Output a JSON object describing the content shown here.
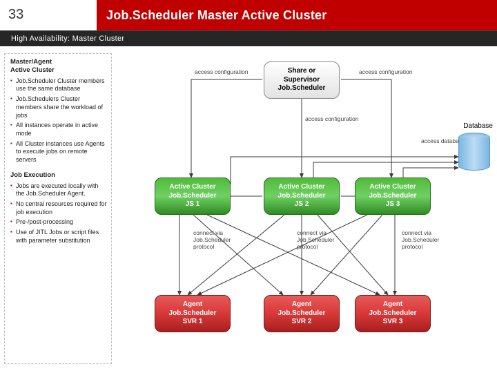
{
  "slide_number": "33",
  "title": "Job.Scheduler Master Active Cluster",
  "subtitle": "High Availability: Master Cluster",
  "sidebar": {
    "h1": "Master/Agent\nActive Cluster",
    "list1": [
      "Job.Scheduler Cluster members use the same database",
      "Job.Schedulers Cluster members share the workload of jobs",
      "All instances operate in active mode",
      "All Cluster instances use Agents to execute jobs on remote servers"
    ],
    "h2": "Job Execution",
    "list2": [
      "Jobs are executed locally with the Job.Scheduler Agent.",
      "No central resources required for job execution",
      "Pre-/post-processing",
      "Use of JITL Jobs or script files with parameter substitution"
    ]
  },
  "diagram": {
    "supervisor": "Share or\nSupervisor\nJob.Scheduler",
    "access_cfg": "access configuration",
    "access_db": "access database",
    "database": "Database",
    "clusters": [
      "Active Cluster\nJob.Scheduler\nJS 1",
      "Active Cluster\nJob.Scheduler\nJS 2",
      "Active Cluster\nJob.Scheduler\nJS 3"
    ],
    "agents": [
      "Agent\nJob.Scheduler\nSVR 1",
      "Agent\nJob.Scheduler\nSVR 2",
      "Agent\nJob.Scheduler\nSVR 3"
    ],
    "connect": "connect via\nJob.Scheduler\nprotocol"
  }
}
